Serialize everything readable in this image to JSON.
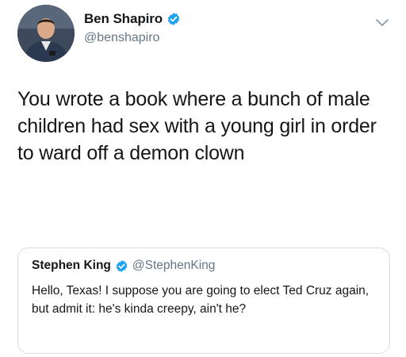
{
  "tweet": {
    "author": {
      "display_name": "Ben Shapiro",
      "handle": "@benshapiro",
      "verified": true,
      "avatar": "avatar-photo"
    },
    "text": "You wrote a book where a bunch of male children had sex with a young girl in order to ward off a demon clown",
    "menu_icon": "chevron-down-icon"
  },
  "quoted_tweet": {
    "author": {
      "display_name": "Stephen King",
      "handle": "@StephenKing",
      "verified": true
    },
    "text": "Hello, Texas! I suppose you are going to elect Ted Cruz again, but admit it: he's kinda creepy, ain't he?"
  },
  "colors": {
    "verified_blue": "#1da1f2",
    "secondary_text": "#657786",
    "border": "#d7dde2"
  }
}
